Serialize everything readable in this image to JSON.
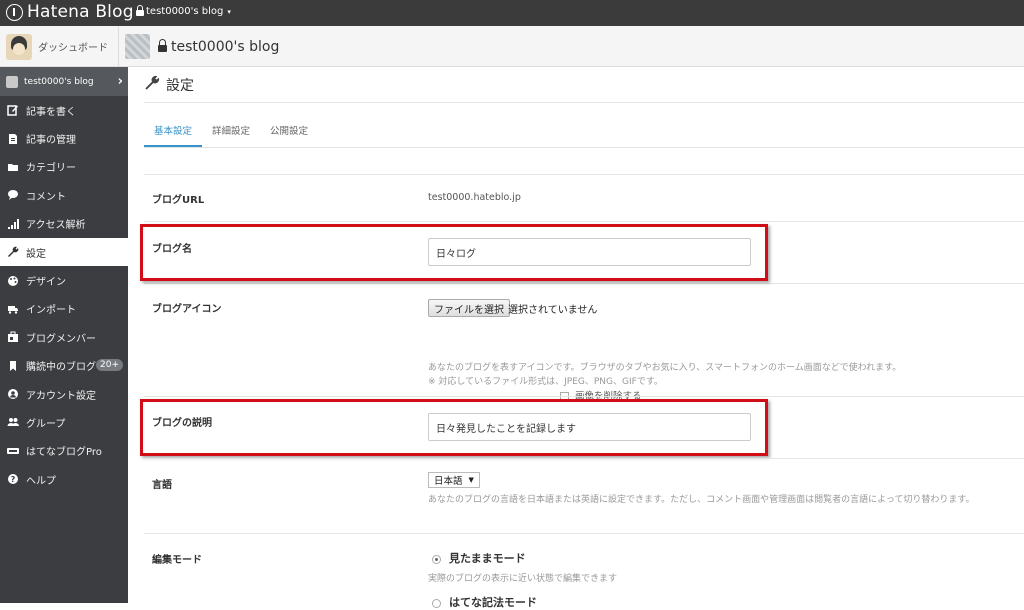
{
  "topbar": {
    "brand": "Hatena Blog",
    "blog_name": "test0000's blog",
    "caret": "▾"
  },
  "subheader": {
    "dashboard_label": "ダッシュボード",
    "blog_title": "test0000's blog"
  },
  "sidebar": {
    "blog_name": "test0000's blog",
    "items": [
      {
        "label": "記事を書く",
        "icon": "pencil-icon"
      },
      {
        "label": "記事の管理",
        "icon": "document-icon"
      },
      {
        "label": "カテゴリー",
        "icon": "folder-icon"
      },
      {
        "label": "コメント",
        "icon": "comment-icon"
      },
      {
        "label": "アクセス解析",
        "icon": "bar-chart-icon"
      },
      {
        "label": "設定",
        "icon": "wrench-icon",
        "active": true
      },
      {
        "label": "デザイン",
        "icon": "palette-icon"
      },
      {
        "label": "インポート",
        "icon": "truck-icon"
      },
      {
        "label": "ブログメンバー",
        "icon": "member-icon"
      },
      {
        "label": "購読中のブログ",
        "icon": "bookmark-icon",
        "badge": "20+"
      },
      {
        "label": "アカウント設定",
        "icon": "account-icon"
      },
      {
        "label": "グループ",
        "icon": "group-icon"
      },
      {
        "label": "はてなブログPro",
        "icon": "pro-icon"
      },
      {
        "label": "ヘルプ",
        "icon": "help-icon"
      }
    ]
  },
  "main": {
    "title": "設定",
    "tabs": [
      "基本設定",
      "詳細設定",
      "公開設定"
    ],
    "blog_url": {
      "label": "ブログURL",
      "value": "test0000.hateblo.jp"
    },
    "blog_name": {
      "label": "ブログ名",
      "value": "日々ログ"
    },
    "blog_icon": {
      "label": "ブログアイコン",
      "file_button": "ファイルを選択",
      "file_status": "選択されていません",
      "delete_label": "画像を削除する",
      "help1": "あなたのブログを表すアイコンです。ブラウザのタブやお気に入り、スマートフォンのホーム画面などで使われます。",
      "help2": "※ 対応しているファイル形式は、JPEG、PNG、GIFです。"
    },
    "blog_description": {
      "label": "ブログの説明",
      "value": "日々発見したことを記録します"
    },
    "language": {
      "label": "言語",
      "selected": "日本語",
      "help": "あなたのブログの言語を日本語または英語に設定できます。ただし、コメント画面や管理画面は閲覧者の言語によって切り替わります。"
    },
    "edit_mode": {
      "label": "編集モード",
      "option1": "見たままモード",
      "option1_help": "実際のブログの表示に近い状態で編集できます",
      "option2": "はてな記法モード"
    }
  },
  "colors": {
    "accent": "#3793c9",
    "highlight": "#d10d16",
    "sidebar": "#3b3d40"
  }
}
